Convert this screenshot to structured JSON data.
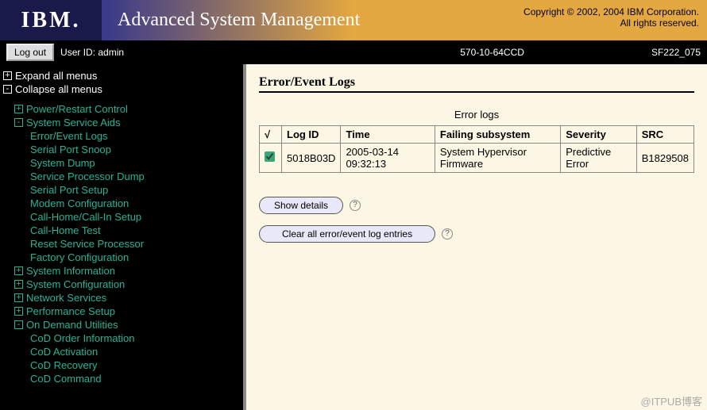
{
  "header": {
    "logo_text": "IBM.",
    "title": "Advanced System Management",
    "copyright_line1": "Copyright © 2002, 2004 IBM Corporation.",
    "copyright_line2": "All rights reserved."
  },
  "userbar": {
    "logout_label": "Log out",
    "user_label": "User ID: admin",
    "machine_id": "570-10-64CCD",
    "firmware": "SF222_075"
  },
  "nav": {
    "expand_all": "Expand all menus",
    "collapse_all": "Collapse all menus",
    "items": [
      {
        "label": "Power/Restart Control",
        "level": 1,
        "box": "+",
        "color": "teal"
      },
      {
        "label": "System Service Aids",
        "level": 1,
        "box": "-",
        "color": "teal"
      },
      {
        "label": "Error/Event Logs",
        "level": 2,
        "color": "teal"
      },
      {
        "label": "Serial Port Snoop",
        "level": 2,
        "color": "teal"
      },
      {
        "label": "System Dump",
        "level": 2,
        "color": "teal"
      },
      {
        "label": "Service Processor Dump",
        "level": 2,
        "color": "teal"
      },
      {
        "label": "Serial Port Setup",
        "level": 2,
        "color": "teal"
      },
      {
        "label": "Modem Configuration",
        "level": 2,
        "color": "teal"
      },
      {
        "label": "Call-Home/Call-In Setup",
        "level": 2,
        "color": "teal"
      },
      {
        "label": "Call-Home Test",
        "level": 2,
        "color": "teal"
      },
      {
        "label": "Reset Service Processor",
        "level": 2,
        "color": "teal"
      },
      {
        "label": "Factory Configuration",
        "level": 2,
        "color": "teal"
      },
      {
        "label": "System Information",
        "level": 1,
        "box": "+",
        "color": "teal"
      },
      {
        "label": "System Configuration",
        "level": 1,
        "box": "+",
        "color": "teal"
      },
      {
        "label": "Network Services",
        "level": 1,
        "box": "+",
        "color": "teal"
      },
      {
        "label": "Performance Setup",
        "level": 1,
        "box": "+",
        "color": "teal"
      },
      {
        "label": "On Demand Utilities",
        "level": 1,
        "box": "-",
        "color": "teal"
      },
      {
        "label": "CoD Order Information",
        "level": 2,
        "color": "teal"
      },
      {
        "label": "CoD Activation",
        "level": 2,
        "color": "teal"
      },
      {
        "label": "CoD Recovery",
        "level": 2,
        "color": "teal"
      },
      {
        "label": "CoD Command",
        "level": 2,
        "color": "teal"
      }
    ]
  },
  "content": {
    "page_title": "Error/Event Logs",
    "section_title": "Error logs",
    "columns": {
      "check": "√",
      "log_id": "Log ID",
      "time": "Time",
      "failing": "Failing subsystem",
      "severity": "Severity",
      "src": "SRC"
    },
    "rows": [
      {
        "checked": true,
        "log_id": "5018B03D",
        "time": "2005-03-14 09:32:13",
        "failing": "System Hypervisor Firmware",
        "severity": "Predictive Error",
        "src": "B1829508"
      }
    ],
    "show_details_label": "Show details",
    "clear_label": "Clear all error/event log entries"
  },
  "watermark": "@ITPUB博客"
}
